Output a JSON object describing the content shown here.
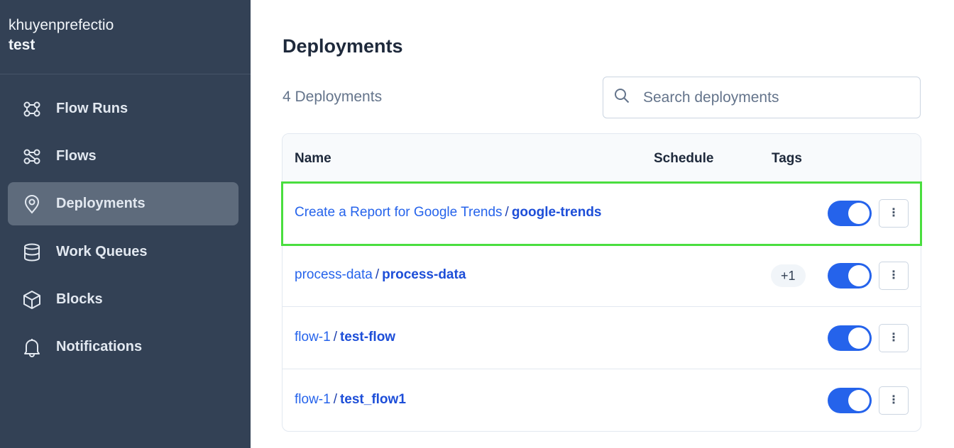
{
  "sidebar": {
    "account": "khuyenprefectio",
    "workspace": "test",
    "items": [
      {
        "label": "Flow Runs",
        "icon": "flow-runs-icon",
        "active": false
      },
      {
        "label": "Flows",
        "icon": "flows-icon",
        "active": false
      },
      {
        "label": "Deployments",
        "icon": "location-pin-icon",
        "active": true
      },
      {
        "label": "Work Queues",
        "icon": "database-icon",
        "active": false
      },
      {
        "label": "Blocks",
        "icon": "cube-icon",
        "active": false
      },
      {
        "label": "Notifications",
        "icon": "bell-icon",
        "active": false
      }
    ]
  },
  "main": {
    "title": "Deployments",
    "count": "4 Deployments",
    "search": {
      "placeholder": "Search deployments",
      "value": ""
    },
    "table": {
      "columns": [
        "Name",
        "Schedule",
        "Tags"
      ],
      "rows": [
        {
          "flow": "Create a Report for Google Trends",
          "separator": "/",
          "deployment": "google-trends",
          "tags": "",
          "active": true,
          "menu": "⋮"
        },
        {
          "flow": "process-data",
          "separator": "/",
          "deployment": "process-data",
          "tags": "+1",
          "active": true,
          "menu": "⋮"
        },
        {
          "flow": "flow-1",
          "separator": "/",
          "deployment": "test-flow",
          "tags": "",
          "active": true,
          "menu": "⋮"
        },
        {
          "flow": "flow-1",
          "separator": "/",
          "deployment": "test_flow1",
          "tags": "",
          "active": true,
          "menu": "⋮"
        }
      ]
    }
  },
  "colors": {
    "sidebar_bg": "#334155",
    "active_item_bg": "#5e6b7c",
    "link": "#2563eb",
    "toggle_on": "#2563eb",
    "highlight": "#4ade3f"
  }
}
